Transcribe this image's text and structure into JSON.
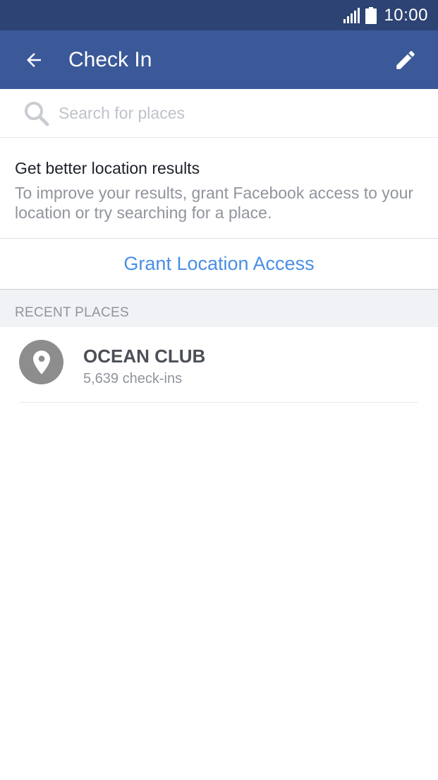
{
  "status_bar": {
    "time": "10:00",
    "signal_icon": "signal-icon",
    "battery_icon": "battery-icon"
  },
  "app_bar": {
    "title": "Check In",
    "back_icon": "back-arrow-icon",
    "edit_icon": "pencil-icon",
    "background_color": "#3b5998"
  },
  "search": {
    "placeholder": "Search for places",
    "value": "",
    "icon": "search-icon"
  },
  "location_prompt": {
    "heading": "Get better location results",
    "body": "To improve your results, grant Facebook access to your location or try searching for a place.",
    "action_label": "Grant Location Access",
    "action_color": "#4a8ee6"
  },
  "recent_places": {
    "header": "RECENT PLACES",
    "items": [
      {
        "name": "OCEAN CLUB",
        "checkins": "5,639 check-ins",
        "icon": "location-pin-icon"
      }
    ]
  }
}
